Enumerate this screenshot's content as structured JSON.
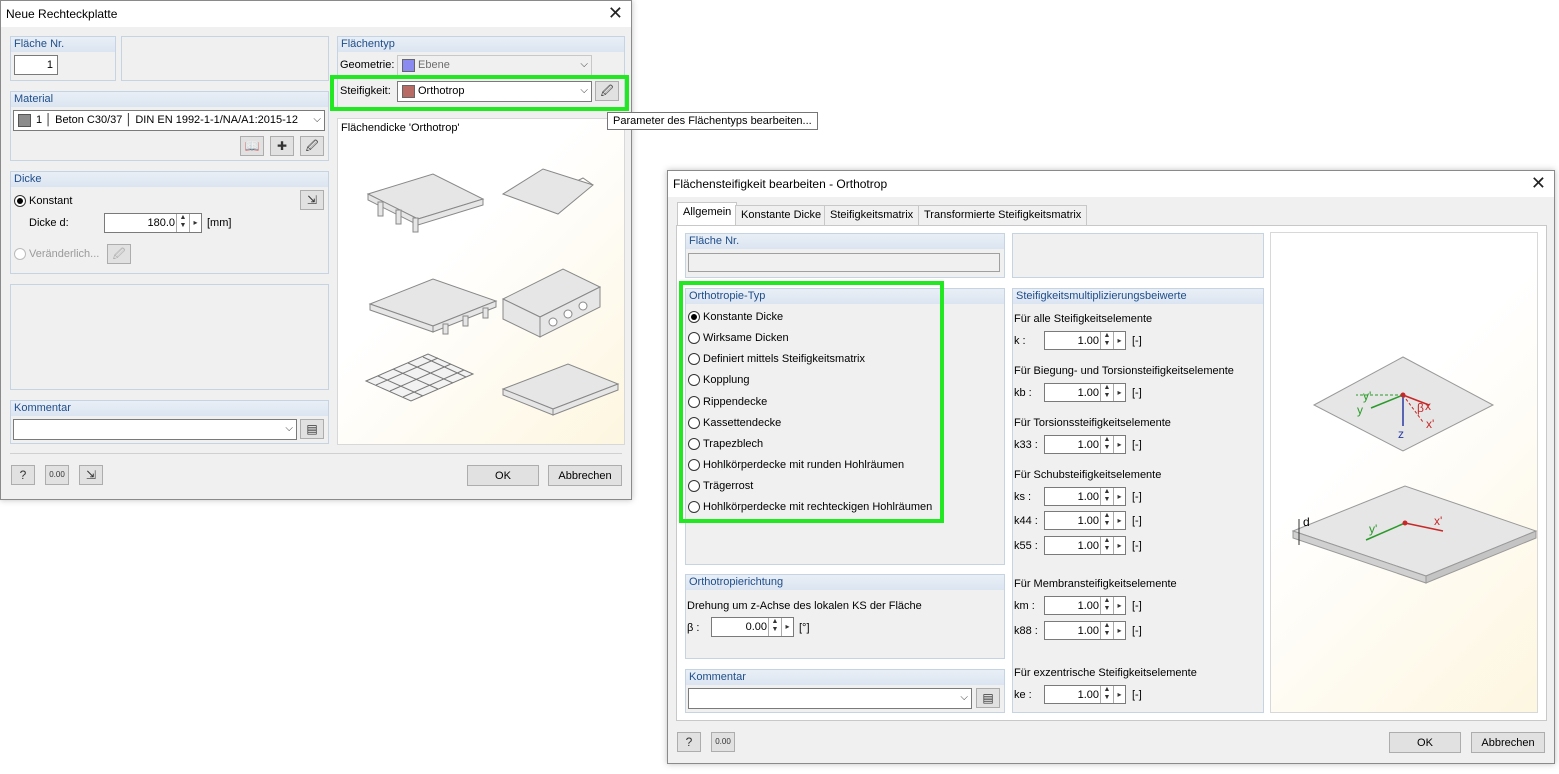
{
  "dialog1": {
    "title": "Neue Rechteckplatte",
    "flaeche_nr_label": "Fläche Nr.",
    "flaeche_nr_value": "1",
    "material_label": "Material",
    "material_value": "1 │ Beton C30/37 │ DIN EN 1992-1-1/NA/A1:2015-12",
    "dicke_label": "Dicke",
    "konstant_label": "Konstant",
    "dicke_d_label": "Dicke d:",
    "dicke_d_value": "180.0",
    "dicke_unit": "[mm]",
    "veraenderlich_label": "Veränderlich...",
    "kommentar_label": "Kommentar",
    "flaechentyp_label": "Flächentyp",
    "geometrie_label": "Geometrie:",
    "geometrie_value": "Ebene",
    "steifigkeit_label": "Steifigkeit:",
    "steifigkeit_value": "Orthotrop",
    "preview_title": "Flächendicke 'Orthotrop'",
    "tooltip": "Parameter des Flächentyps bearbeiten...",
    "ok_label": "OK",
    "cancel_label": "Abbrechen",
    "units_icon_text": "0.00"
  },
  "dialog2": {
    "title": "Flächensteifigkeit bearbeiten - Orthotrop",
    "tabs": [
      "Allgemein",
      "Konstante Dicke",
      "Steifigkeitsmatrix",
      "Transformierte Steifigkeitsmatrix"
    ],
    "flaeche_nr_label": "Fläche Nr.",
    "orthotropie_typ_label": "Orthotropie-Typ",
    "types": [
      "Konstante Dicke",
      "Wirksame Dicken",
      "Definiert mittels Steifigkeitsmatrix",
      "Kopplung",
      "Rippendecke",
      "Kassettendecke",
      "Trapezblech",
      "Hohlkörperdecke mit runden Hohlräumen",
      "Trägerrost",
      "Hohlkörperdecke mit rechteckigen Hohlräumen"
    ],
    "richtung_label": "Orthotropierichtung",
    "drehung_label": "Drehung um z-Achse des lokalen KS der Fläche",
    "beta_label": "β :",
    "beta_value": "0.00",
    "beta_unit": "[°]",
    "kommentar_label": "Kommentar",
    "multi_label": "Steifigkeitsmultiplizierungsbeiwerte",
    "sections": {
      "all": "Für alle Steifigkeitselemente",
      "bending": "Für Biegung- und Torsionsteifigkeitselemente",
      "torsion": "Für Torsionssteifigkeitselemente",
      "shear": "Für Schubsteifigkeitselemente",
      "membrane": "Für Membransteifigkeitselemente",
      "eccentric": "Für exzentrische Steifigkeitselemente"
    },
    "factors": {
      "k": {
        "label": "k :",
        "value": "1.00"
      },
      "kb": {
        "label": "kb :",
        "value": "1.00"
      },
      "k33": {
        "label": "k33 :",
        "value": "1.00"
      },
      "ks": {
        "label": "ks :",
        "value": "1.00"
      },
      "k44": {
        "label": "k44 :",
        "value": "1.00"
      },
      "k55": {
        "label": "k55 :",
        "value": "1.00"
      },
      "km": {
        "label": "km :",
        "value": "1.00"
      },
      "k88": {
        "label": "k88 :",
        "value": "1.00"
      },
      "ke": {
        "label": "ke :",
        "value": "1.00"
      }
    },
    "unit": "[-]",
    "diagram": {
      "y_prime": "y'",
      "y": "y",
      "x": "x",
      "x_prime": "x'",
      "z": "z",
      "beta": "β",
      "d": "d"
    },
    "ok_label": "OK",
    "cancel_label": "Abbrechen",
    "units_icon_text": "0.00"
  },
  "colors": {
    "highlight": "#22e822",
    "group_header": "#1f4e8c",
    "material_swatch": "#8c8c8c",
    "geometry_swatch": "#8a8af0",
    "stiffness_swatch": "#b86a64"
  }
}
